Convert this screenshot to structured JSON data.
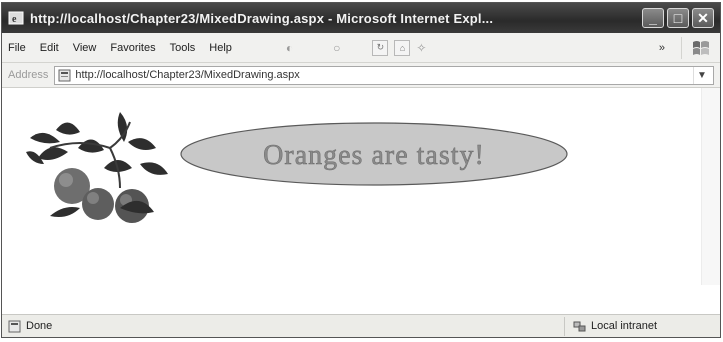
{
  "window": {
    "title": "http://localhost/Chapter23/MixedDrawing.aspx - Microsoft Internet Expl...",
    "buttons": [
      "_",
      "□",
      "✕"
    ]
  },
  "menu": {
    "items": [
      "File",
      "Edit",
      "View",
      "Favorites",
      "Tools",
      "Help"
    ],
    "overflow": "»"
  },
  "address": {
    "label": "Address",
    "url": "http://localhost/Chapter23/MixedDrawing.aspx"
  },
  "content": {
    "ellipse_text": "Oranges are tasty!",
    "ellipse_fill": "#c8c8c8",
    "text_color": "#8a8a8a"
  },
  "status": {
    "left": "Done",
    "zone": "Local intranet"
  },
  "icons": {
    "app": "ie-icon",
    "page": "page-icon",
    "status": "status-page-icon",
    "zone": "intranet-icon",
    "logo": "windows-logo-icon"
  }
}
